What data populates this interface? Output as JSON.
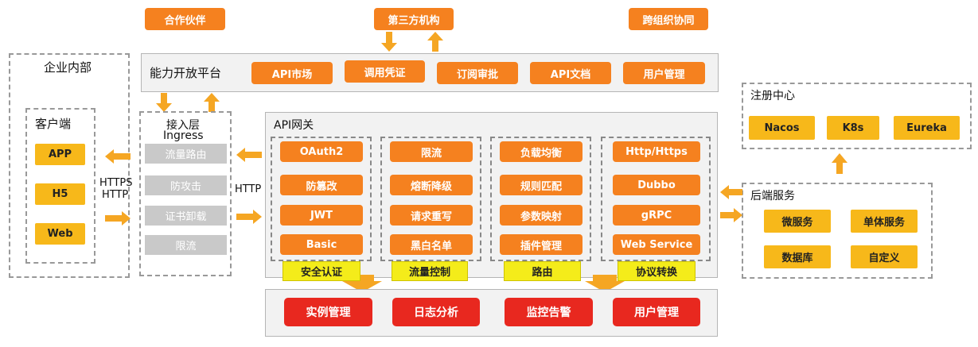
{
  "partners": {
    "p1": "合作伙伴",
    "p2": "第三方机构",
    "p3": "跨组织协同"
  },
  "platform": {
    "title": "能力开放平台",
    "items": [
      "API市场",
      "调用凭证",
      "订阅审批",
      "API文档",
      "用户管理"
    ]
  },
  "enterprise": {
    "title": "企业内部",
    "client_title": "客户端",
    "clients": [
      "APP",
      "H5",
      "Web"
    ],
    "protocol_1": "HTTPS",
    "protocol_2": "HTTP"
  },
  "ingress": {
    "title_1": "接入层",
    "title_2": "Ingress",
    "items": [
      "流量路由",
      "防攻击",
      "证书卸载",
      "限流"
    ]
  },
  "gateway": {
    "title": "API网关",
    "http_label": "HTTP",
    "groups": [
      {
        "items": [
          "OAuth2",
          "防篡改",
          "JWT",
          "Basic"
        ],
        "label": "安全认证"
      },
      {
        "items": [
          "限流",
          "熔断降级",
          "请求重写",
          "黑白名单"
        ],
        "label": "流量控制"
      },
      {
        "items": [
          "负载均衡",
          "规则匹配",
          "参数映射",
          "插件管理"
        ],
        "label": "路由"
      },
      {
        "items": [
          "Http/Https",
          "Dubbo",
          "gRPC",
          "Web Service"
        ],
        "label": "协议转换"
      }
    ]
  },
  "ops": {
    "items": [
      "实例管理",
      "日志分析",
      "监控告警",
      "用户管理"
    ]
  },
  "registry": {
    "title": "注册中心",
    "items": [
      "Nacos",
      "K8s",
      "Eureka"
    ]
  },
  "backend": {
    "title": "后端服务",
    "items": [
      "微服务",
      "单体服务",
      "数据库",
      "自定义"
    ]
  },
  "colors": {
    "orange": "#f5811f",
    "red": "#e8281f",
    "gold": "#f7b81a",
    "yellow": "#f4ec1a",
    "gray": "#c9c9c9"
  }
}
